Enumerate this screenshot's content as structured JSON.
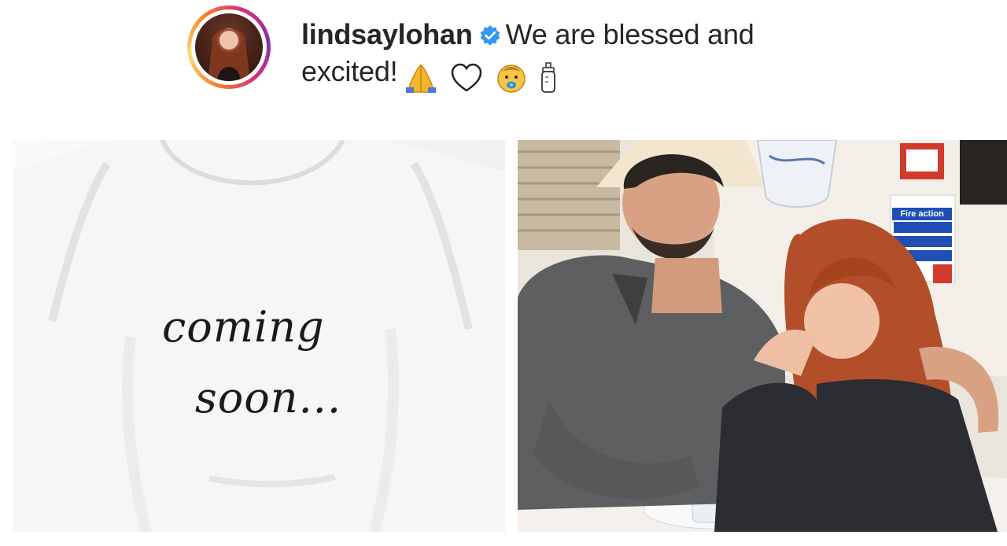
{
  "post": {
    "username": "lindsaylohan",
    "caption_line1": "We are blessed and",
    "caption_line2": "excited!",
    "emojis": [
      "folded-hands-icon",
      "white-heart-icon",
      "baby-icon",
      "baby-bottle-icon"
    ]
  },
  "images": {
    "left": {
      "text_line1": "coming",
      "text_line2": "soon..."
    },
    "right": {
      "sign_text": "Fire action"
    }
  },
  "colors": {
    "verified": "#3797f0",
    "text": "#262626"
  }
}
